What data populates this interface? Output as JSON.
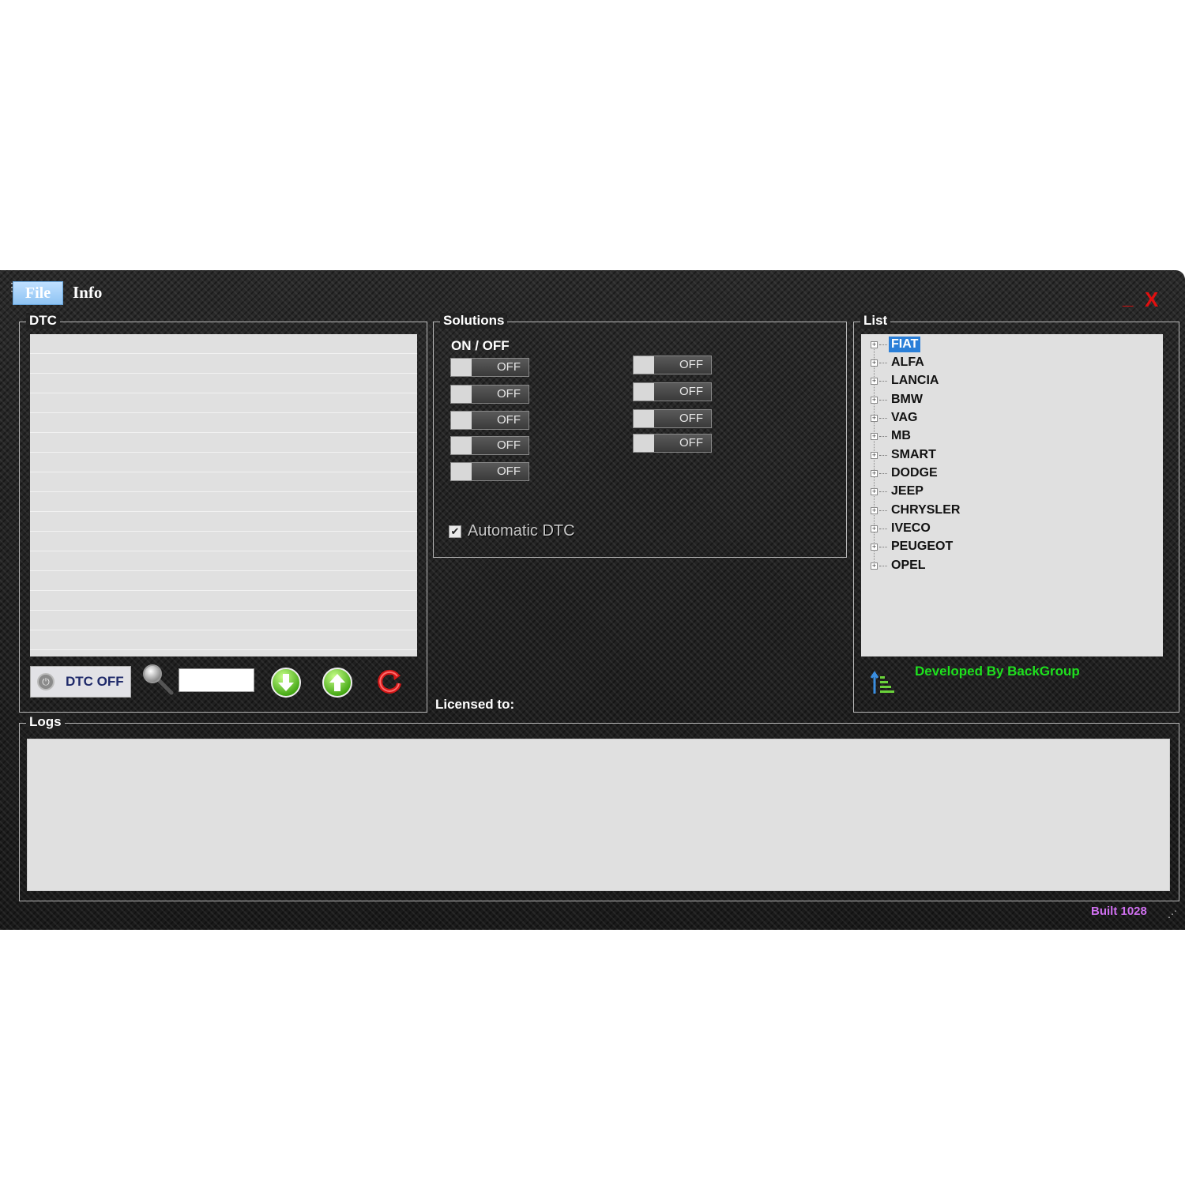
{
  "menu": {
    "file": "File",
    "info": "Info"
  },
  "window_controls": {
    "minimize": "_",
    "close": "X"
  },
  "dtc": {
    "title": "DTC",
    "button_label": "DTC OFF",
    "search_value": ""
  },
  "solutions": {
    "title": "Solutions",
    "header": "ON   /  OFF",
    "left_toggles": [
      "OFF",
      "OFF",
      "OFF",
      "OFF",
      "OFF"
    ],
    "right_toggles": [
      "OFF",
      "OFF",
      "OFF",
      "OFF"
    ],
    "auto_dtc_label": "Automatic DTC",
    "auto_dtc_checked": true
  },
  "licensed": "Licensed to:",
  "list": {
    "title": "List",
    "items": [
      "FIAT",
      "ALFA",
      "LANCIA",
      "BMW",
      "VAG",
      "MB",
      "SMART",
      "DODGE",
      "JEEP",
      "CHRYSLER",
      "IVECO",
      "PEUGEOT",
      "OPEL"
    ],
    "selected": "FIAT"
  },
  "developed_by": "Developed By BackGroup",
  "logs": {
    "title": "Logs"
  },
  "build": "Built 1028",
  "colors": {
    "accent_selection": "#2a7fd8",
    "developer_text": "#1ee01e",
    "build_text": "#d070f0",
    "close_button": "#e01010"
  }
}
